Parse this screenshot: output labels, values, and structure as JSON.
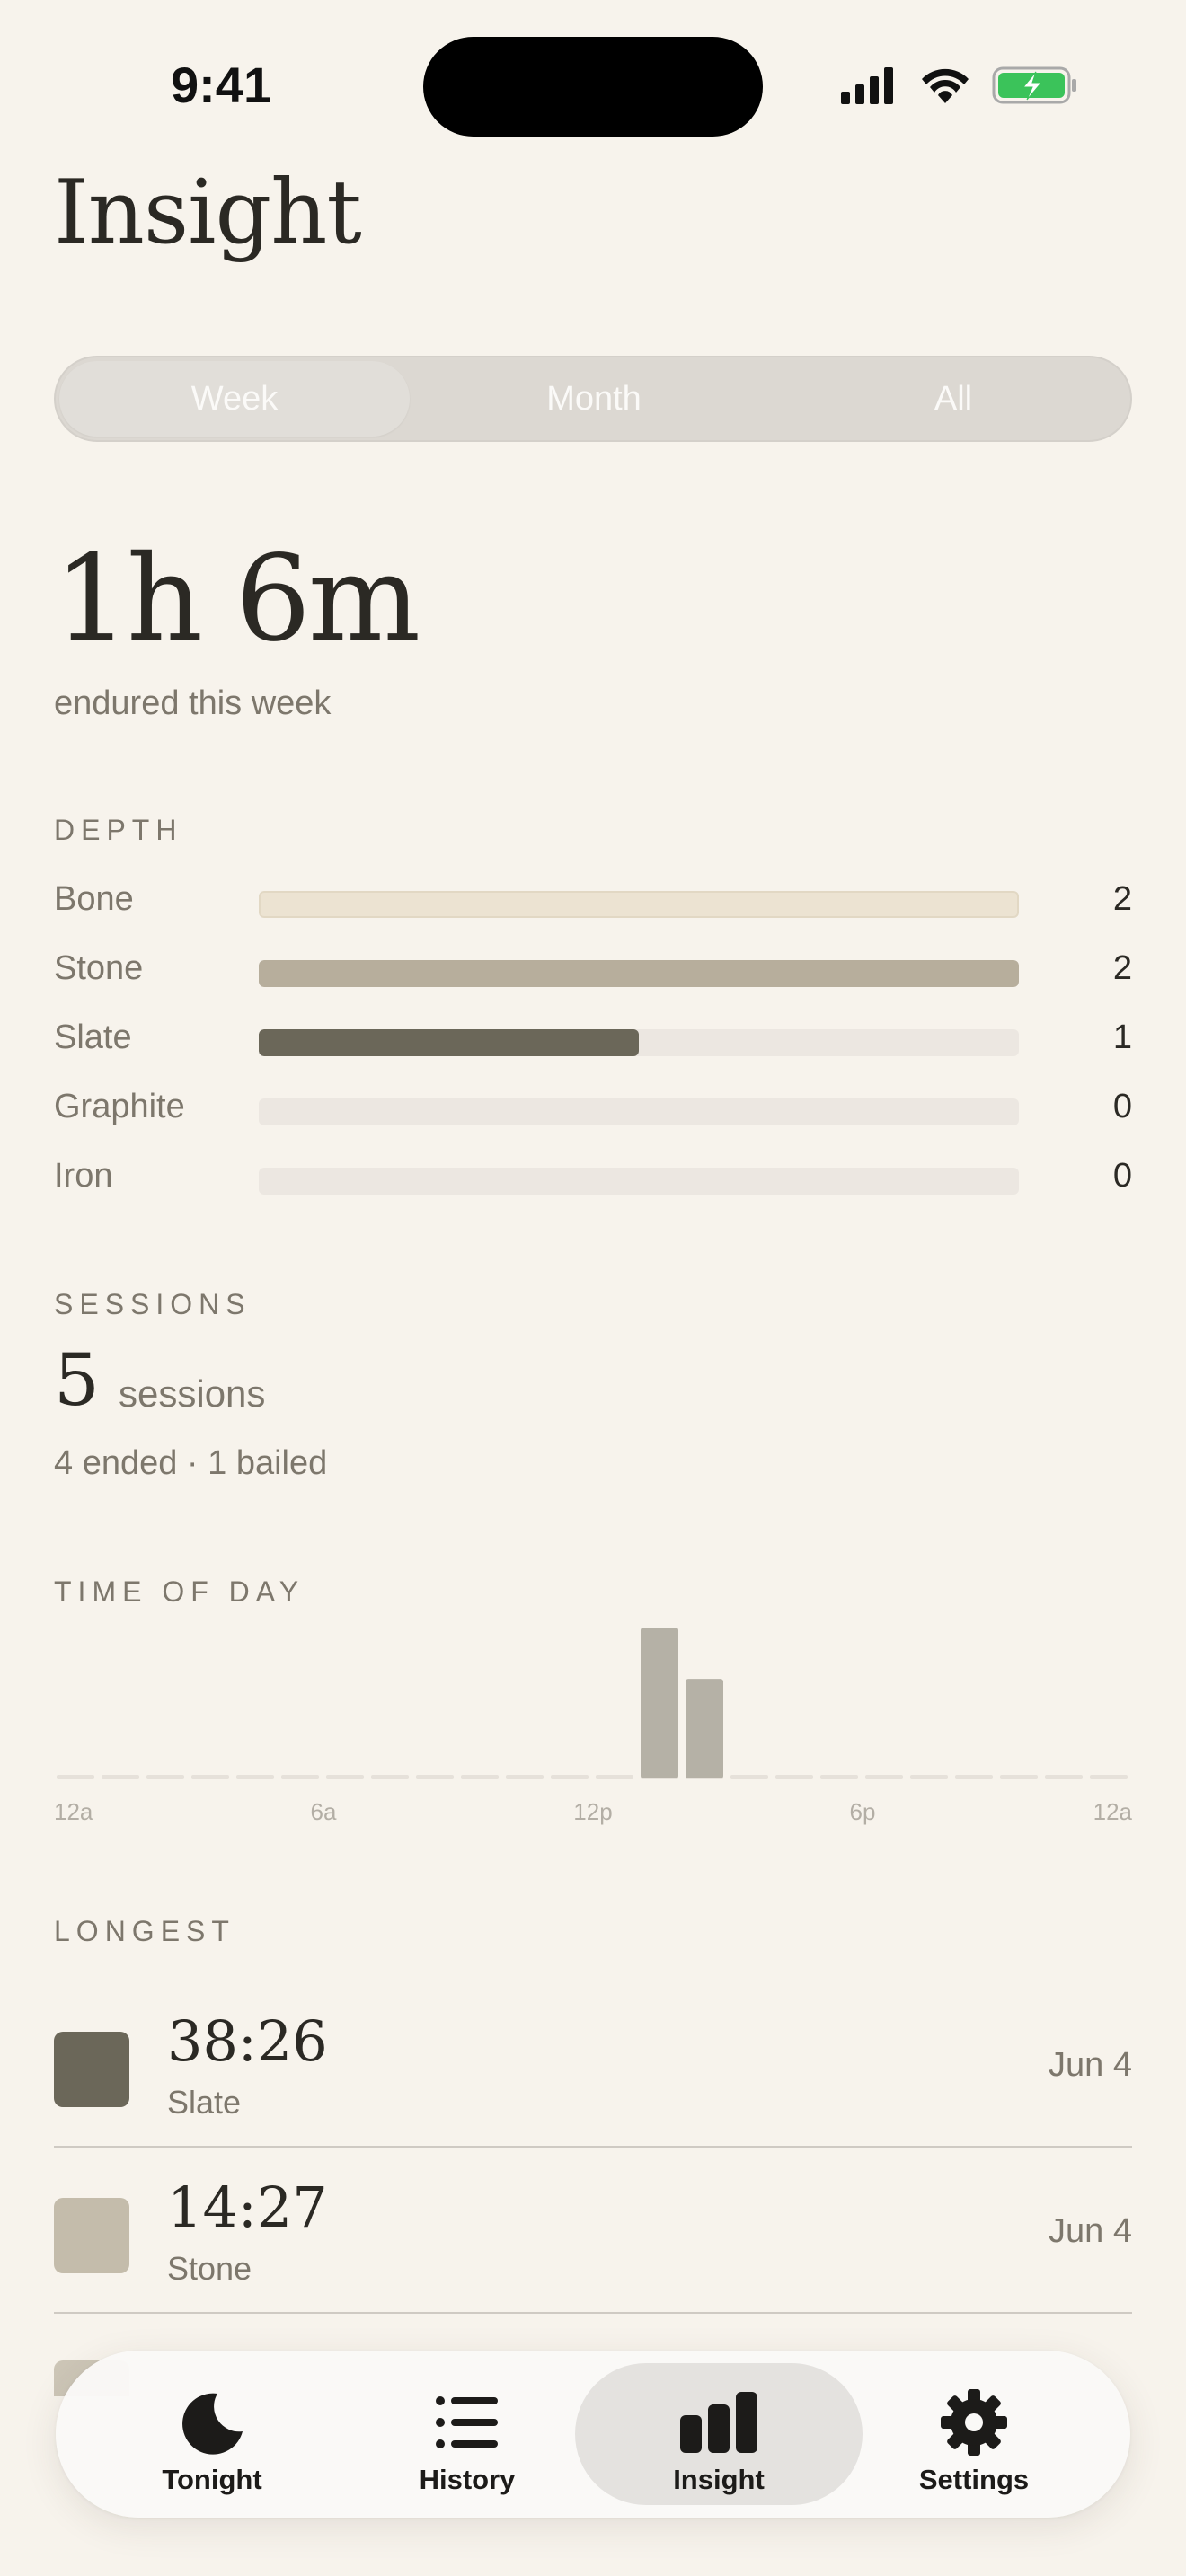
{
  "status": {
    "time": "9:41"
  },
  "title": "Insight",
  "range": {
    "options": [
      "Week",
      "Month",
      "All"
    ],
    "selected": "Week"
  },
  "summary": {
    "total": "1h 6m",
    "caption": "endured this week"
  },
  "depth": {
    "label": "DEPTH",
    "max": 2,
    "rows": [
      {
        "name": "Bone",
        "count": 2,
        "fill_fraction": 1.0,
        "color": "#ece3d2"
      },
      {
        "name": "Stone",
        "count": 2,
        "fill_fraction": 1.0,
        "color": "#b7ae9c"
      },
      {
        "name": "Slate",
        "count": 1,
        "fill_fraction": 0.5,
        "color": "#6b6759"
      },
      {
        "name": "Graphite",
        "count": 0,
        "fill_fraction": 0,
        "color": "#ece7e1"
      },
      {
        "name": "Iron",
        "count": 0,
        "fill_fraction": 0,
        "color": "#ece7e1"
      }
    ]
  },
  "sessions": {
    "label": "SESSIONS",
    "count": "5",
    "word": "sessions",
    "detail": "4 ended · 1 bailed"
  },
  "chart_data": {
    "type": "bar",
    "title": "TIME OF DAY",
    "x_ticks": [
      "12a",
      "6a",
      "12p",
      "6p",
      "12a"
    ],
    "bins_per_day": 24,
    "values": [
      0,
      0,
      0,
      0,
      0,
      0,
      0,
      0,
      0,
      0,
      0,
      0,
      0,
      1,
      0.66,
      0,
      0,
      0,
      0,
      0,
      0,
      0,
      0,
      0
    ],
    "ylim": [
      0,
      1
    ],
    "bar_color": "#b5b1a6",
    "baseline_color": "#e6e1da"
  },
  "longest": {
    "label": "LONGEST",
    "items": [
      {
        "time": "38:26",
        "depth": "Slate",
        "date": "Jun 4",
        "color": "#6b6759"
      },
      {
        "time": "14:27",
        "depth": "Stone",
        "date": "Jun 4",
        "color": "#c4bcab"
      }
    ]
  },
  "tabs": [
    {
      "label": "Tonight",
      "icon": "moon-icon"
    },
    {
      "label": "History",
      "icon": "list-icon"
    },
    {
      "label": "Insight",
      "icon": "bar-chart-icon",
      "active": true
    },
    {
      "label": "Settings",
      "icon": "gear-icon"
    }
  ]
}
